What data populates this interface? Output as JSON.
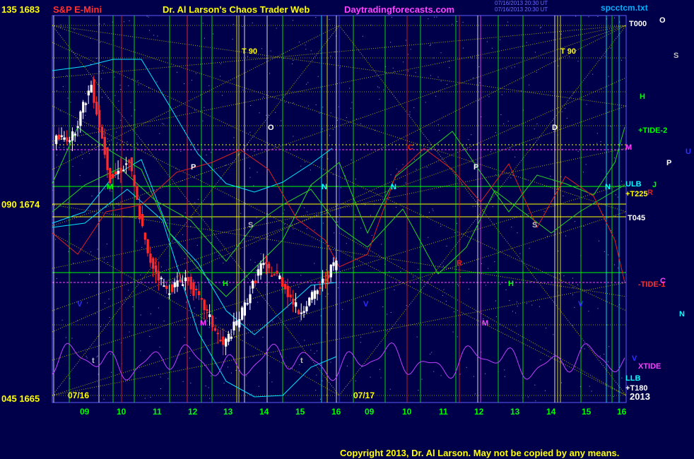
{
  "header": {
    "left_label": "S&P E-Mini",
    "title": "Dr. Al Larson's Chaos Trader Web",
    "site": "Daytradingforecasts.com",
    "timestamp_line1": "07/16/2013 20:30 UT",
    "timestamp_line2": "07/16/2013 20:30 UT",
    "file_name": "spcctcm.txt"
  },
  "footer": {
    "copyright": "Copyright 2013, Dr. Al Larson. May not be copied by any means."
  },
  "colors": {
    "background": "#00004a",
    "border": "#5a5aff",
    "price_up": "#ffffff",
    "price_down": "#ff2a2a",
    "day_marker": "#ffffff",
    "hour_grid": "#00c800",
    "gann_lines": "#e6e600",
    "xtide": "#c040ff",
    "cyan_band": "#00e5ff",
    "green_band": "#28d228",
    "red_band": "#e02020"
  },
  "chart_data": {
    "type": "candlestick",
    "title": "S&P E-Mini",
    "ylim": [
      1665,
      1683
    ],
    "y_ticks": [
      {
        "label": "135",
        "value": "1683"
      },
      {
        "label": "090",
        "value": "1674"
      },
      {
        "label": "045",
        "value": "1665"
      }
    ],
    "x_days": [
      "07/16",
      "07/17"
    ],
    "x_hour_labels": [
      "09",
      "10",
      "11",
      "12",
      "13",
      "14",
      "15",
      "16",
      "09",
      "10",
      "11",
      "12",
      "13",
      "14",
      "15",
      "16"
    ],
    "x_year": "2013",
    "right_labels": [
      "T000",
      "+TIDE-2",
      "ULB",
      "+T225",
      "T045",
      "-TIDE-1",
      "XTIDE",
      "LLB",
      "+T180",
      "2013"
    ],
    "planet_markers": [
      "O",
      "S",
      "H",
      "U",
      "M",
      "P",
      "J",
      "N",
      "V",
      "T 90",
      "D",
      "C",
      "t",
      "R"
    ],
    "candles_hourly": [
      {
        "t": "09",
        "o": 1677.2,
        "h": 1677.8,
        "l": 1676.5,
        "c": 1677.4
      },
      {
        "t": "09",
        "o": 1677.4,
        "h": 1680.5,
        "l": 1677.0,
        "c": 1679.8
      },
      {
        "t": "10",
        "o": 1679.8,
        "h": 1680.2,
        "l": 1674.5,
        "c": 1675.4
      },
      {
        "t": "10",
        "o": 1675.4,
        "h": 1677.6,
        "l": 1674.8,
        "c": 1676.2
      },
      {
        "t": "11",
        "o": 1676.2,
        "h": 1676.4,
        "l": 1671.2,
        "c": 1671.8
      },
      {
        "t": "11",
        "o": 1671.8,
        "h": 1672.4,
        "l": 1669.6,
        "c": 1670.2
      },
      {
        "t": "12",
        "o": 1670.2,
        "h": 1671.4,
        "l": 1669.8,
        "c": 1670.8
      },
      {
        "t": "12",
        "o": 1670.8,
        "h": 1671.0,
        "l": 1668.8,
        "c": 1669.4
      },
      {
        "t": "13",
        "o": 1669.4,
        "h": 1669.8,
        "l": 1667.2,
        "c": 1667.6
      },
      {
        "t": "13",
        "o": 1667.6,
        "h": 1669.6,
        "l": 1667.2,
        "c": 1669.2
      },
      {
        "t": "14",
        "o": 1669.2,
        "h": 1672.5,
        "l": 1669.0,
        "c": 1671.4
      },
      {
        "t": "14",
        "o": 1671.4,
        "h": 1672.0,
        "l": 1670.4,
        "c": 1670.8
      },
      {
        "t": "15",
        "o": 1670.8,
        "h": 1671.0,
        "l": 1668.5,
        "c": 1669.2
      },
      {
        "t": "15",
        "o": 1669.2,
        "h": 1670.5,
        "l": 1668.8,
        "c": 1670.2
      },
      {
        "t": "16",
        "o": 1670.2,
        "h": 1672.2,
        "l": 1670.0,
        "c": 1671.6
      }
    ]
  }
}
